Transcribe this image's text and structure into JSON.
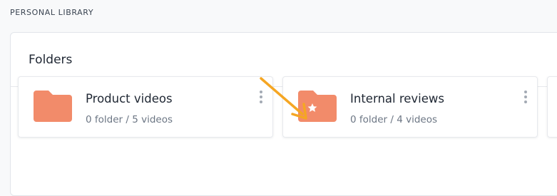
{
  "library": {
    "section_label": "PERSONAL LIBRARY",
    "panel_title": "Folders"
  },
  "folders": [
    {
      "name": "Product videos",
      "meta": "0 folder / 5 videos",
      "icon": "folder-icon",
      "starred": false
    },
    {
      "name": "Internal reviews",
      "meta": "0 folder / 4 videos",
      "icon": "folder-star-icon",
      "starred": true
    }
  ],
  "colors": {
    "folder_icon": "#f28b6a",
    "annotation_arrow": "#f5a623",
    "page_background": "#f8f9fa"
  }
}
